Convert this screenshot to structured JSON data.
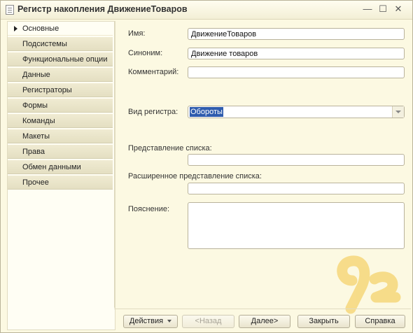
{
  "window": {
    "title": "Регистр накопления ДвижениеТоваров",
    "minimize": "—",
    "maximize": "☐",
    "close": "✕"
  },
  "sidebar": {
    "items": [
      {
        "label": "Основные",
        "active": true
      },
      {
        "label": "Подсистемы"
      },
      {
        "label": "Функциональные опции"
      },
      {
        "label": "Данные"
      },
      {
        "label": "Регистраторы"
      },
      {
        "label": "Формы"
      },
      {
        "label": "Команды"
      },
      {
        "label": "Макеты"
      },
      {
        "label": "Права"
      },
      {
        "label": "Обмен данными"
      },
      {
        "label": "Прочее"
      }
    ]
  },
  "form": {
    "name_label": "Имя:",
    "name_value": "ДвижениеТоваров",
    "synonym_label": "Синоним:",
    "synonym_value": "Движение товаров",
    "comment_label": "Комментарий:",
    "comment_value": "",
    "register_type_label": "Вид регистра:",
    "register_type_value": "Обороты",
    "list_presentation_label": "Представление списка:",
    "list_presentation_value": "",
    "extended_list_presentation_label": "Расширенное представление списка:",
    "extended_list_presentation_value": "",
    "explanation_label": "Пояснение:"
  },
  "footer": {
    "actions": "Действия",
    "back": "<Назад",
    "next": "Далее>",
    "close": "Закрыть",
    "help": "Справка"
  },
  "colors": {
    "background": "#fcf9e2",
    "selection": "#2f5cae",
    "watermark": "#f6d77a"
  }
}
